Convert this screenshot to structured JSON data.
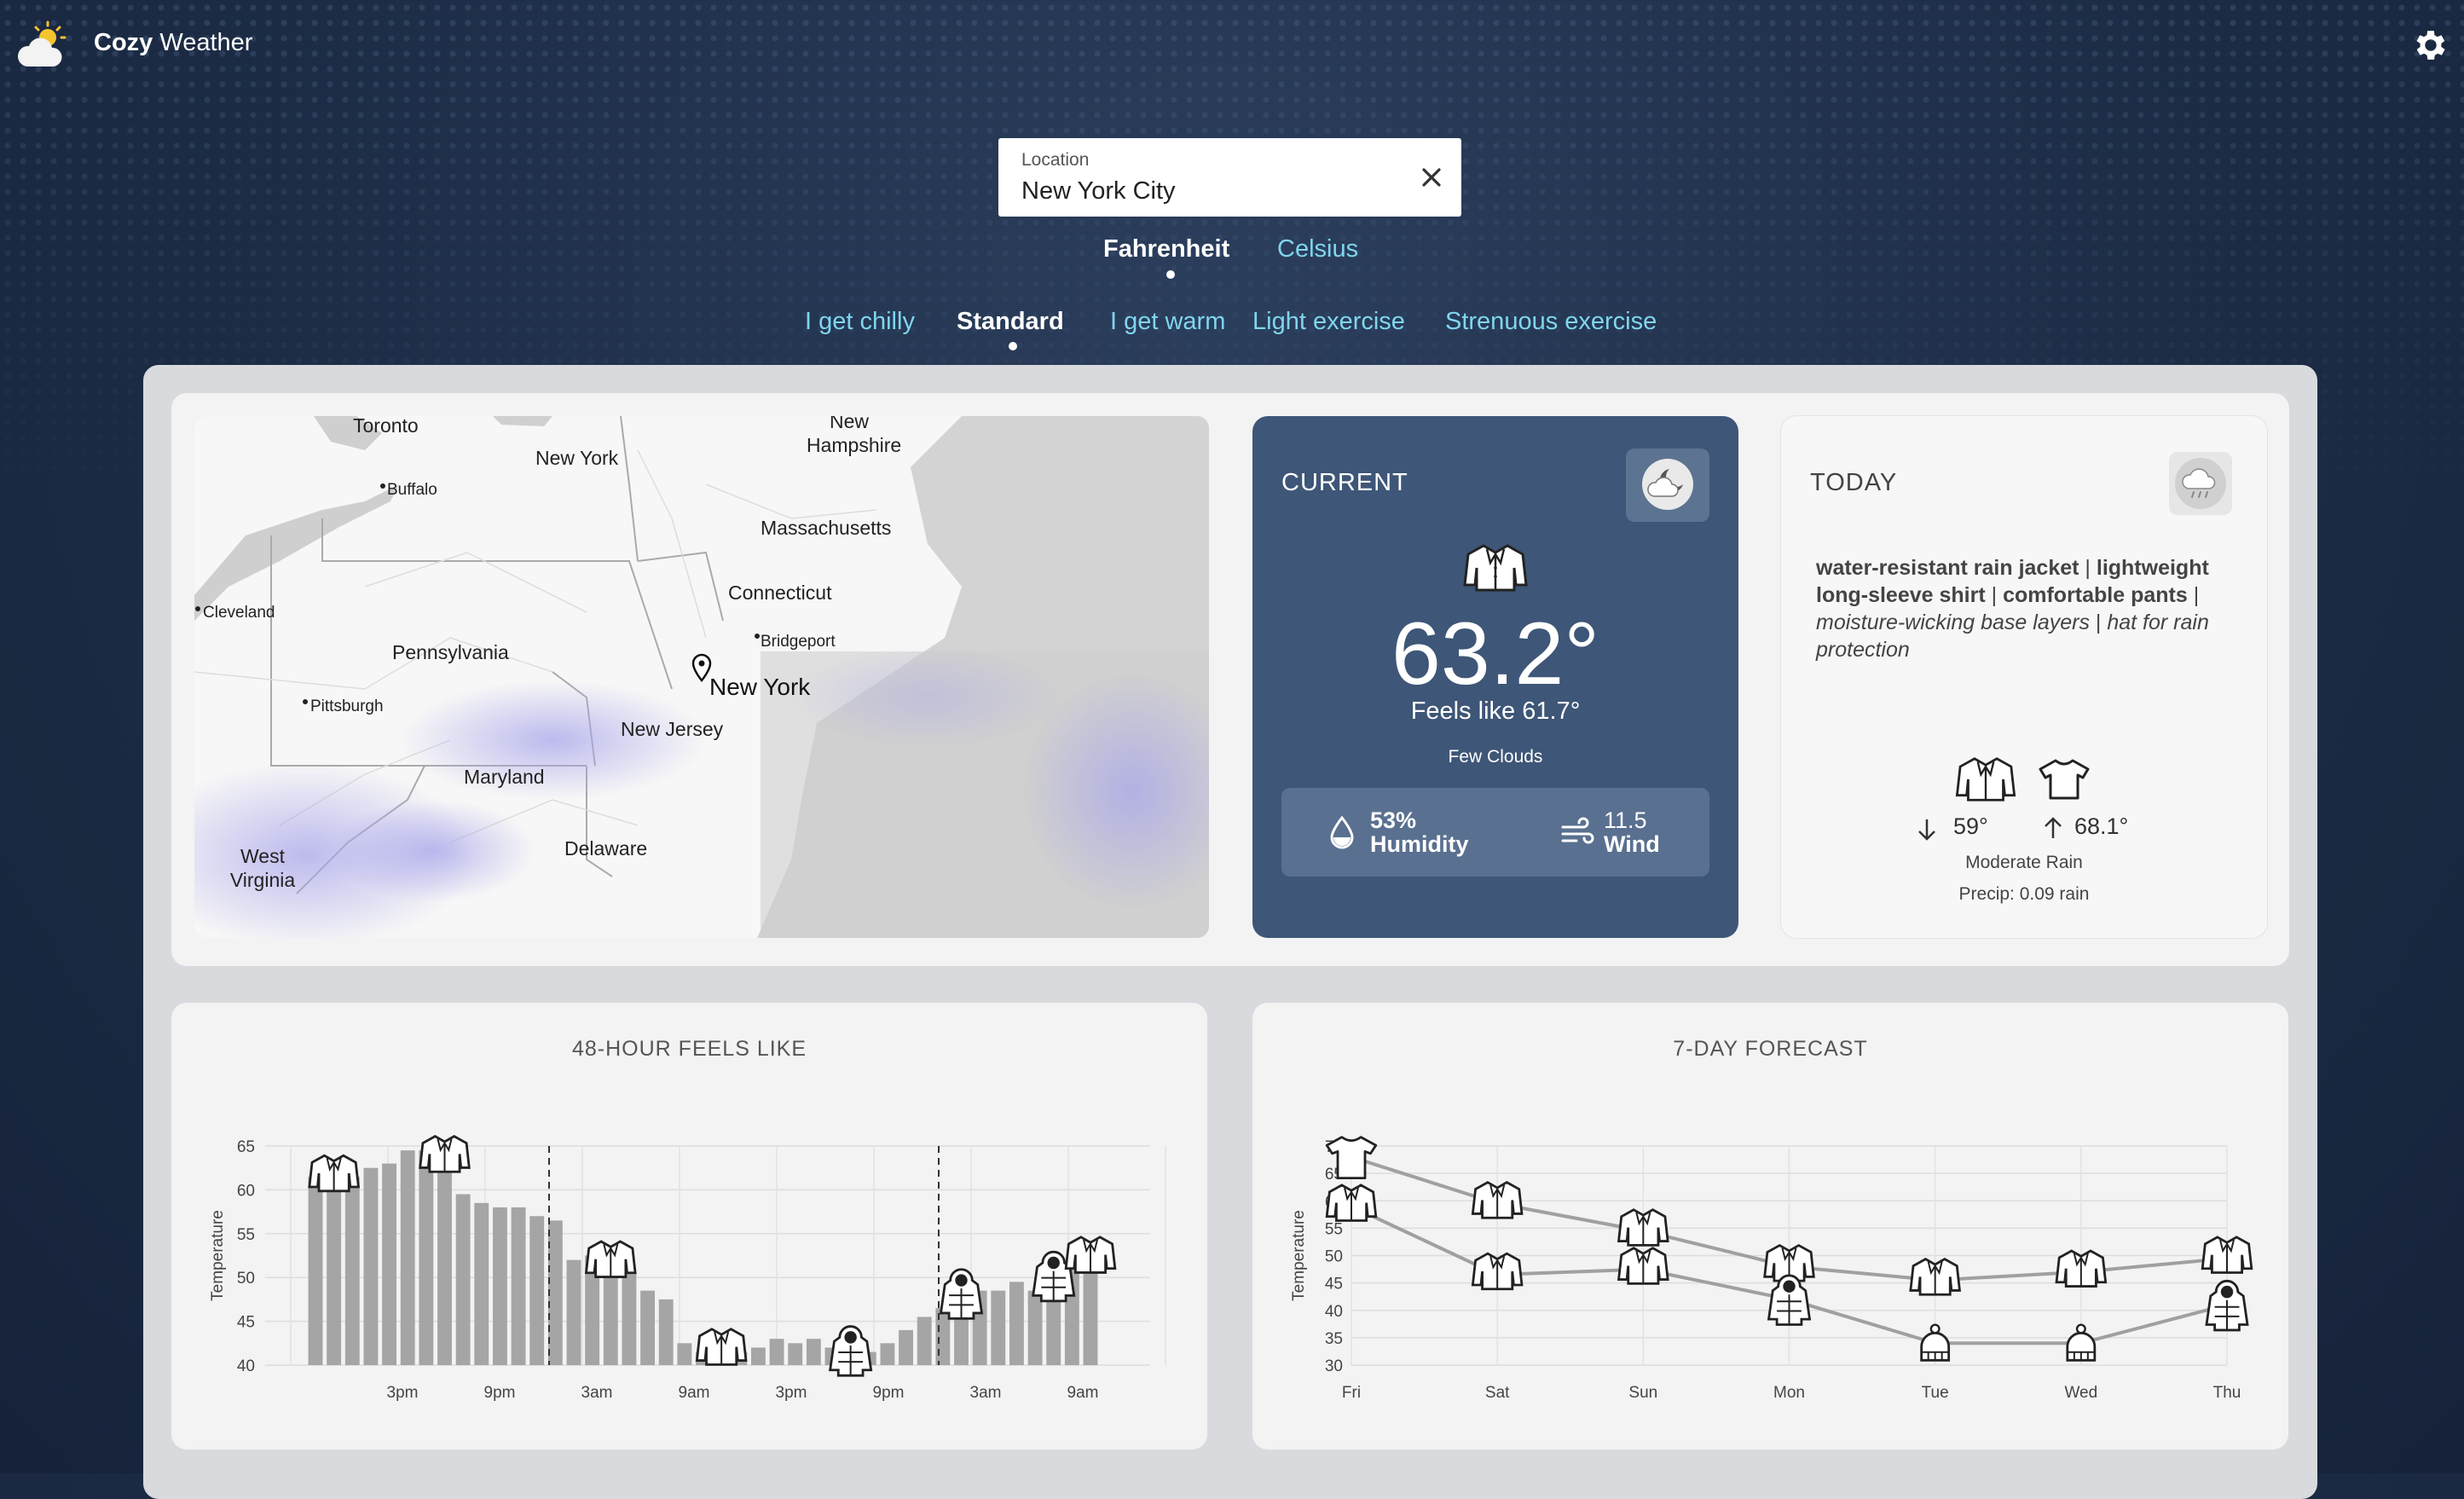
{
  "app": {
    "title_bold": "Cozy",
    "title_rest": "Weather"
  },
  "location": {
    "label": "Location",
    "value": "New York City"
  },
  "units": {
    "options": [
      "Fahrenheit",
      "Celsius"
    ],
    "selected": "Fahrenheit"
  },
  "profiles": {
    "options": [
      "I get chilly",
      "Standard",
      "I get warm",
      "Light exercise",
      "Strenuous exercise"
    ],
    "selected": "Standard"
  },
  "map": {
    "labels": [
      "Toronto",
      "New York",
      "Buffalo",
      "New Hampshire",
      "Massachusetts",
      "Connecticut",
      "Cleveland",
      "Pennsylvania",
      "Bridgeport",
      "New York",
      "Pittsburgh",
      "New Jersey",
      "Maryland",
      "West Virginia",
      "Delaware"
    ]
  },
  "current": {
    "title": "CURRENT",
    "temp": "63.2°",
    "feels": "Feels like 61.7°",
    "condition": "Few Clouds",
    "humidity_value": "53%",
    "humidity_label": "Humidity",
    "wind_value": "11.5",
    "wind_label": "Wind",
    "icon": "cloudy-night-icon"
  },
  "today": {
    "title": "TODAY",
    "icon": "rain-cloud-icon",
    "items": [
      {
        "text": "water-resistant rain jacket",
        "style": "bold"
      },
      {
        "text": "lightweight long-sleeve shirt",
        "style": "bold"
      },
      {
        "text": "comfortable pants",
        "style": "bold"
      },
      {
        "text": "moisture-wicking base layers",
        "style": "italic"
      },
      {
        "text": "hat for rain protection",
        "style": "italic"
      }
    ],
    "low": "59°",
    "high": "68.1°",
    "condition": "Moderate Rain",
    "precip": "Precip: 0.09 rain"
  },
  "chart_data": [
    {
      "type": "bar",
      "title": "48-HOUR FEELS LIKE",
      "ylabel": "Temperature",
      "ylim": [
        40,
        65
      ],
      "yticks": [
        40,
        45,
        50,
        55,
        60,
        65
      ],
      "xticks": [
        "3pm",
        "9pm",
        "3am",
        "9am",
        "3pm",
        "9pm",
        "3am",
        "9am"
      ],
      "values": [
        61.5,
        61.3,
        61.5,
        62.5,
        63,
        64.5,
        64.5,
        63.5,
        59.5,
        58.5,
        58,
        58,
        57,
        56.5,
        52,
        52.5,
        51.5,
        50.5,
        48.5,
        47.5,
        42.5,
        41.5,
        41.5,
        41.5,
        42,
        43,
        42.5,
        43,
        42,
        41.5,
        41.5,
        42.5,
        44,
        45.5,
        46.5,
        48,
        48.5,
        48.5,
        49.5,
        48.5,
        50,
        51,
        52
      ],
      "day_dividers": [
        "12am",
        "12am"
      ],
      "icons": [
        "jacket",
        "jacket",
        "jacket",
        "jacket",
        "puffer-coat",
        "puffer-coat",
        "puffer-coat",
        "jacket"
      ]
    },
    {
      "type": "line",
      "title": "7-DAY FORECAST",
      "ylabel": "Temperature",
      "ylim": [
        30,
        70
      ],
      "yticks": [
        30,
        35,
        40,
        45,
        50,
        55,
        60,
        65,
        70
      ],
      "categories": [
        "Fri",
        "Sat",
        "Sun",
        "Mon",
        "Tue",
        "Wed",
        "Thu"
      ],
      "series": [
        {
          "values": [
            68,
            59.5,
            54.5,
            48,
            45.5,
            47,
            49.5
          ]
        },
        {
          "values": [
            59,
            46.5,
            47.5,
            42,
            34,
            34,
            41
          ]
        }
      ],
      "icons_high": [
        "t-shirt",
        "jacket",
        "jacket",
        "jacket",
        "jacket",
        "jacket",
        "jacket"
      ],
      "icons_low": [
        "jacket",
        "jacket",
        "jacket",
        "puffer-coat",
        "beanie",
        "beanie",
        "puffer-coat"
      ]
    }
  ]
}
